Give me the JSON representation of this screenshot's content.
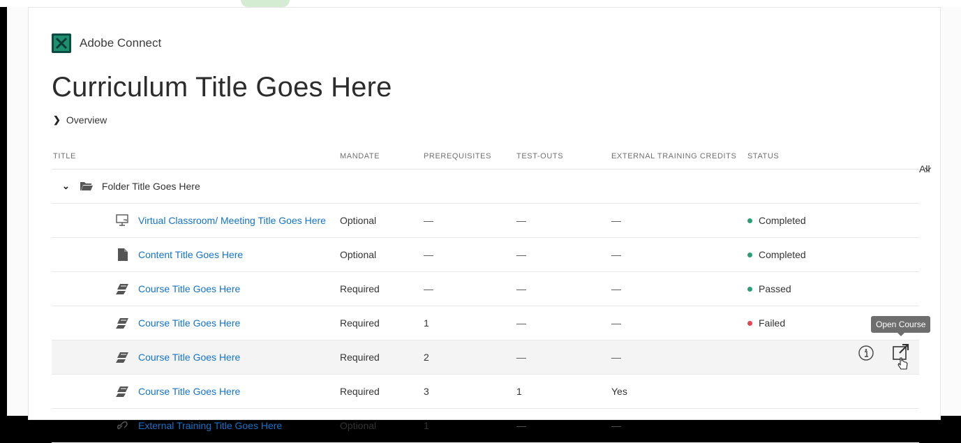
{
  "app": {
    "name": "Adobe Connect"
  },
  "page": {
    "title": "Curriculum Title Goes Here",
    "overview_label": "Overview"
  },
  "table": {
    "headers": {
      "title": "TITLE",
      "mandate": "MANDATE",
      "prerequisites": "PREREQUISITES",
      "testouts": "TEST-OUTS",
      "credits": "EXTERNAL TRAINING CREDITS",
      "status": "STATUS",
      "filter": "All"
    },
    "folder": {
      "title": "Folder Title Goes Here"
    },
    "rows": [
      {
        "icon": "monitor-icon",
        "title": "Virtual Classroom/ Meeting Title Goes Here",
        "mandate": "Optional",
        "prereq": "—",
        "testouts": "—",
        "credits": "—",
        "status": "Completed",
        "status_color": "#2d9d78"
      },
      {
        "icon": "document-icon",
        "title": "Content Title Goes Here",
        "mandate": "Optional",
        "prereq": "—",
        "testouts": "—",
        "credits": "—",
        "status": "Completed",
        "status_color": "#2d9d78"
      },
      {
        "icon": "course-icon",
        "title": "Course Title Goes Here",
        "mandate": "Required",
        "prereq": "—",
        "testouts": "—",
        "credits": "—",
        "status": "Passed",
        "status_color": "#2d9d78"
      },
      {
        "icon": "course-icon",
        "title": "Course Title Goes Here",
        "mandate": "Required",
        "prereq": "1",
        "testouts": "—",
        "credits": "—",
        "status": "Failed",
        "status_color": "#e34850"
      },
      {
        "icon": "course-icon",
        "title": "Course Title Goes Here",
        "mandate": "Required",
        "prereq": "2",
        "testouts": "—",
        "credits": "—",
        "status": "",
        "status_color": ""
      },
      {
        "icon": "course-icon",
        "title": "Course Title Goes Here",
        "mandate": "Required",
        "prereq": "3",
        "testouts": "1",
        "credits": "Yes",
        "status": "",
        "status_color": ""
      },
      {
        "icon": "link-icon",
        "title": "External Training Title Goes Here",
        "mandate": "Optional",
        "prereq": "1",
        "testouts": "—",
        "credits": "—",
        "status": "",
        "status_color": ""
      }
    ]
  },
  "tooltip": {
    "label": "Open Course"
  },
  "colors": {
    "link": "#1473c9",
    "brand": "#0b4a41",
    "completed": "#2d9d78",
    "failed": "#e34850"
  }
}
